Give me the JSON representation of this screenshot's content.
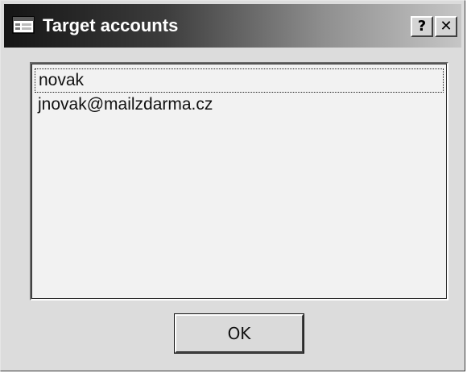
{
  "window": {
    "title": "Target accounts",
    "help_label": "?",
    "close_label": "✕"
  },
  "accounts": {
    "items": [
      "novak",
      "jnovak@mailzdarma.cz"
    ],
    "focused_item": "novak"
  },
  "buttons": {
    "ok_label": "OK"
  },
  "icons": {
    "app": "dialog-window-icon",
    "help": "question-mark-icon",
    "close": "close-icon"
  },
  "colors": {
    "title_bar_start": "#151515",
    "title_bar_end": "#c6c6c6",
    "dialog_face": "#dcdcdc",
    "list_background": "#f2f2f2"
  }
}
